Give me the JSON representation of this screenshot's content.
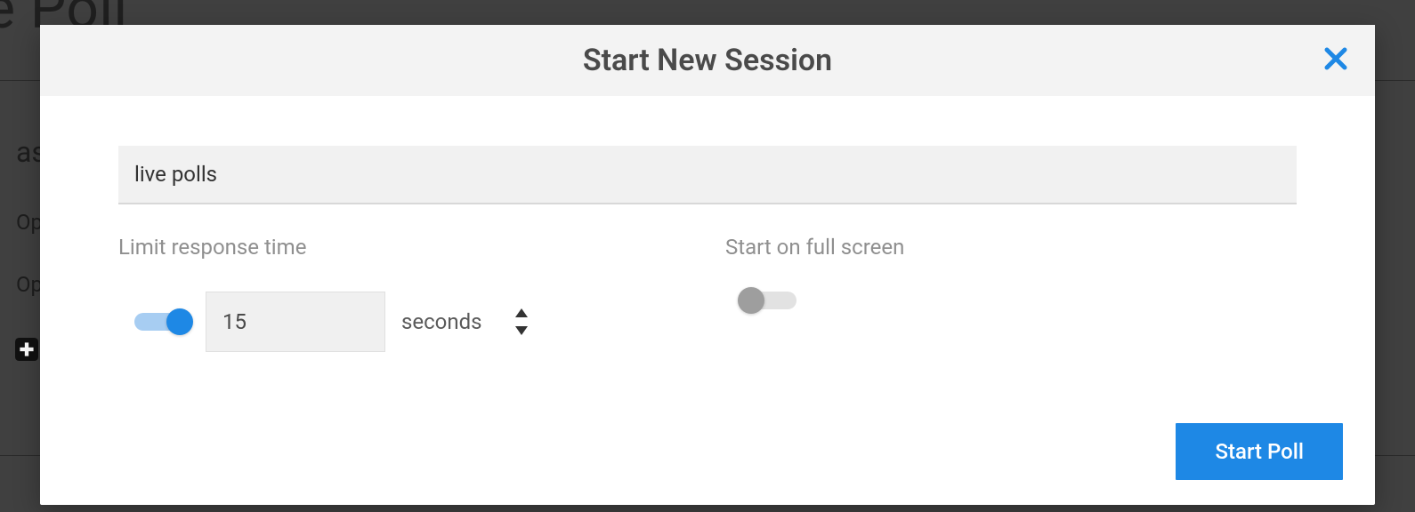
{
  "background": {
    "page_title_fragment": "ve Poll",
    "row1_prefix": "as",
    "row2_prefix": "Op",
    "row3_prefix": "Op"
  },
  "modal": {
    "title": "Start New Session",
    "session_name": {
      "value": "live polls"
    },
    "limit_response": {
      "label": "Limit response time",
      "enabled": true,
      "value": "15",
      "unit": "seconds"
    },
    "full_screen": {
      "label": "Start on full screen",
      "enabled": false
    },
    "start_button": "Start Poll"
  }
}
